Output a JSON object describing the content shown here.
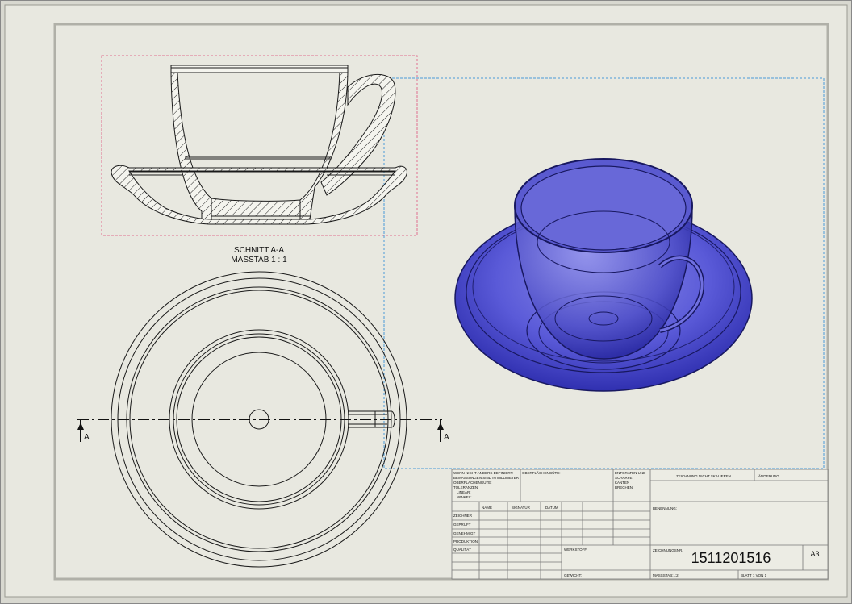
{
  "drawing": {
    "section_label": "SCHNITT A-A",
    "scale_label": "MASSTAB 1 : 1",
    "cut_marker": "A",
    "drawing_number": "1511201516",
    "sheet_size": "A3",
    "colors": {
      "sheet": "#e8e8e0",
      "frame": "#b8b8b0",
      "linework": "#1a1a1a",
      "view_box_pink": "#e07090",
      "view_box_blue": "#4a9ad8",
      "shaded_model": "#4848c8"
    }
  },
  "title_block": {
    "notes": [
      "WENN NICHT ANDERS DEFINIERT:",
      "BEMASSUNGEN SIND IN MILLIMETER",
      "OBERFLÄCHENGÜTE:",
      "TOLERANZEN:",
      "LINEAR:",
      "WINKEL:"
    ],
    "finish": "OBERFLÄCHENGÜTE:",
    "deburr": [
      "ENTGRATEN UND",
      "SCHARFE",
      "KANTEN",
      "BRECHEN"
    ],
    "no_scale": "ZEICHNUNG NICHT SKALIEREN",
    "revision": "ÄNDERUNG",
    "col_headers": [
      "NAME",
      "SIGNATUR",
      "DATUM"
    ],
    "roles": [
      "ZEICHNER",
      "GEPRÜFT",
      "GENEHMIGT",
      "PRODUKTION",
      "QUALITÄT"
    ],
    "material": "WERKSTOFF:",
    "weight": "GEWICHT:",
    "designation": "BENENNUNG:",
    "drawing_no_label": "ZEICHNUNGSNR.",
    "scale_field": "MASSSTAB:1:2",
    "sheet_field": "BLATT 1 VON 1"
  }
}
